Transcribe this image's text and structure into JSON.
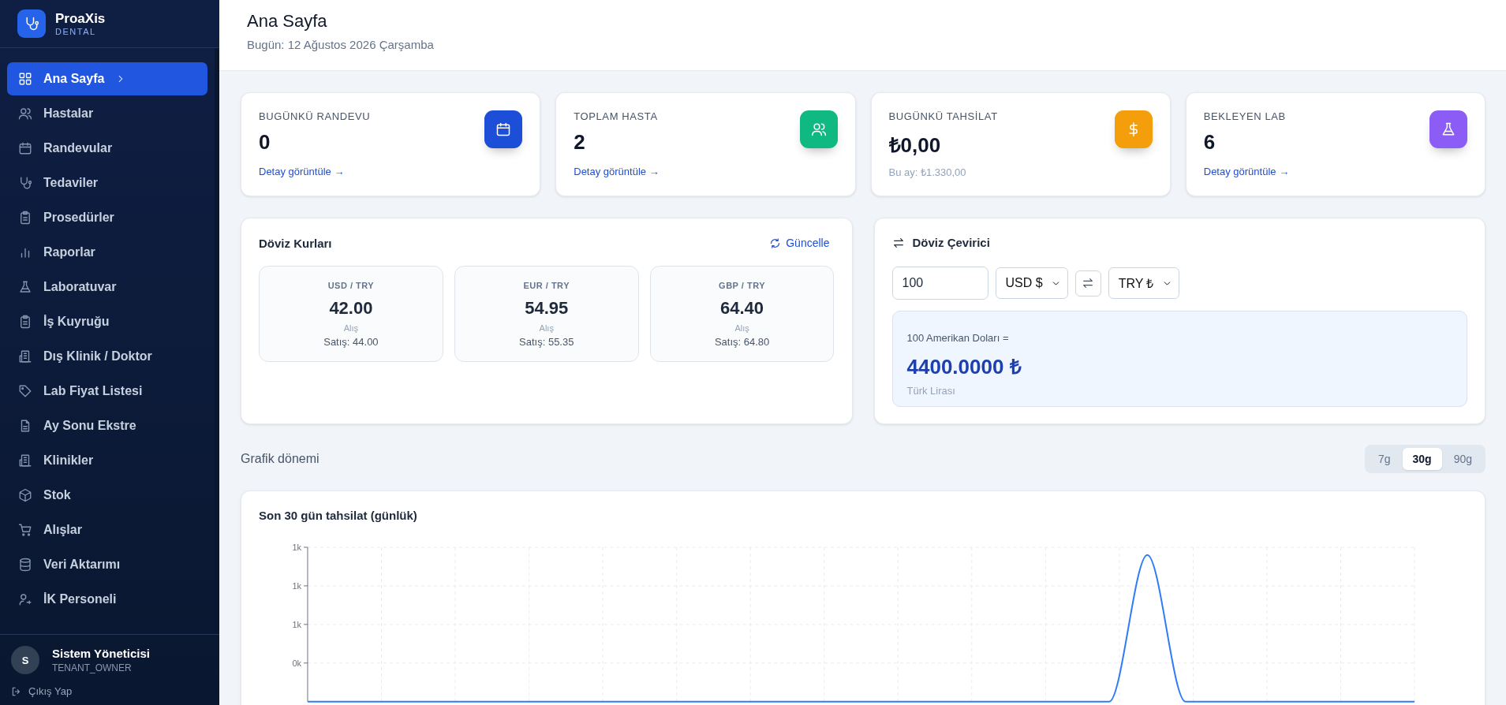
{
  "brand": {
    "name": "ProaXis",
    "subtitle": "DENTAL"
  },
  "sidebar": {
    "items": [
      {
        "label": "Ana Sayfa",
        "selected": true
      },
      {
        "label": "Hastalar",
        "selected": false
      },
      {
        "label": "Randevular",
        "selected": false
      },
      {
        "label": "Tedaviler",
        "selected": false
      },
      {
        "label": "Prosedürler",
        "selected": false
      },
      {
        "label": "Raporlar",
        "selected": false
      },
      {
        "label": "Laboratuvar",
        "selected": false
      },
      {
        "label": "İş Kuyruğu",
        "selected": false
      },
      {
        "label": "Dış Klinik / Doktor",
        "selected": false
      },
      {
        "label": "Lab Fiyat Listesi",
        "selected": false
      },
      {
        "label": "Ay Sonu Ekstre",
        "selected": false
      },
      {
        "label": "Klinikler",
        "selected": false
      },
      {
        "label": "Stok",
        "selected": false
      },
      {
        "label": "Alışlar",
        "selected": false
      },
      {
        "label": "Veri Aktarımı",
        "selected": false
      },
      {
        "label": "İK Personeli",
        "selected": false
      }
    ],
    "user": {
      "initial": "S",
      "name": "Sistem Yöneticisi",
      "role": "TENANT_OWNER"
    },
    "logout": "Çıkış Yap"
  },
  "header": {
    "title": "Ana Sayfa",
    "date": "Bugün: 12 Ağustos 2026 Çarşamba"
  },
  "stat_cards": [
    {
      "label": "BUGÜNKÜ RANDEVU",
      "value": "0",
      "link": "Detay görüntüle →",
      "color": "#1d4ed8"
    },
    {
      "label": "TOPLAM HASTA",
      "value": "2",
      "link": "Detay görüntüle →",
      "color": "#10b981"
    },
    {
      "label": "BUGÜNKÜ TAHSİLAT",
      "value": "₺0,00",
      "note": "Bu ay: ₺1.330,00",
      "color": "#f59e0b"
    },
    {
      "label": "BEKLEYEN LAB",
      "value": "6",
      "link": "Detay görüntüle →",
      "color": "#8b5cf6"
    }
  ],
  "rates": {
    "title": "Döviz Kurları",
    "refresh": "Güncelle",
    "items": [
      {
        "pair": "USD / TRY",
        "buy": "42.00",
        "buy_label": "Alış",
        "sell": "Satış: 44.00"
      },
      {
        "pair": "EUR / TRY",
        "buy": "54.95",
        "buy_label": "Alış",
        "sell": "Satış: 55.35"
      },
      {
        "pair": "GBP / TRY",
        "buy": "64.40",
        "buy_label": "Alış",
        "sell": "Satış: 64.80"
      }
    ]
  },
  "converter": {
    "title": "Döviz Çevirici",
    "amount": "100",
    "from": "USD $",
    "to": "TRY ₺",
    "result_caption": "100 Amerikan Doları =",
    "result": "4400.0000 ₺",
    "result_unit": "Türk Lirası"
  },
  "period": {
    "label": "Grafik dönemi",
    "options": [
      {
        "label": "7g",
        "selected": false
      },
      {
        "label": "30g",
        "selected": true
      },
      {
        "label": "90g",
        "selected": false
      }
    ]
  },
  "chart": {
    "chart_data": {
      "type": "line",
      "title": "Son 30 gün tahsilat (günlük)",
      "ylim": [
        0,
        1400
      ],
      "yticks": [
        {
          "value": 350,
          "label": "0k"
        },
        {
          "value": 700,
          "label": "1k"
        },
        {
          "value": 1050,
          "label": "1k"
        },
        {
          "value": 1400,
          "label": "1k"
        }
      ],
      "grid": true,
      "series": [
        {
          "color": "#2f7cf6",
          "values": [
            0,
            0,
            0,
            0,
            0,
            0,
            0,
            0,
            0,
            0,
            0,
            0,
            0,
            0,
            0,
            0,
            0,
            0,
            0,
            0,
            0,
            0,
            1330,
            0,
            0,
            0,
            0,
            0,
            0,
            0
          ]
        }
      ]
    }
  }
}
